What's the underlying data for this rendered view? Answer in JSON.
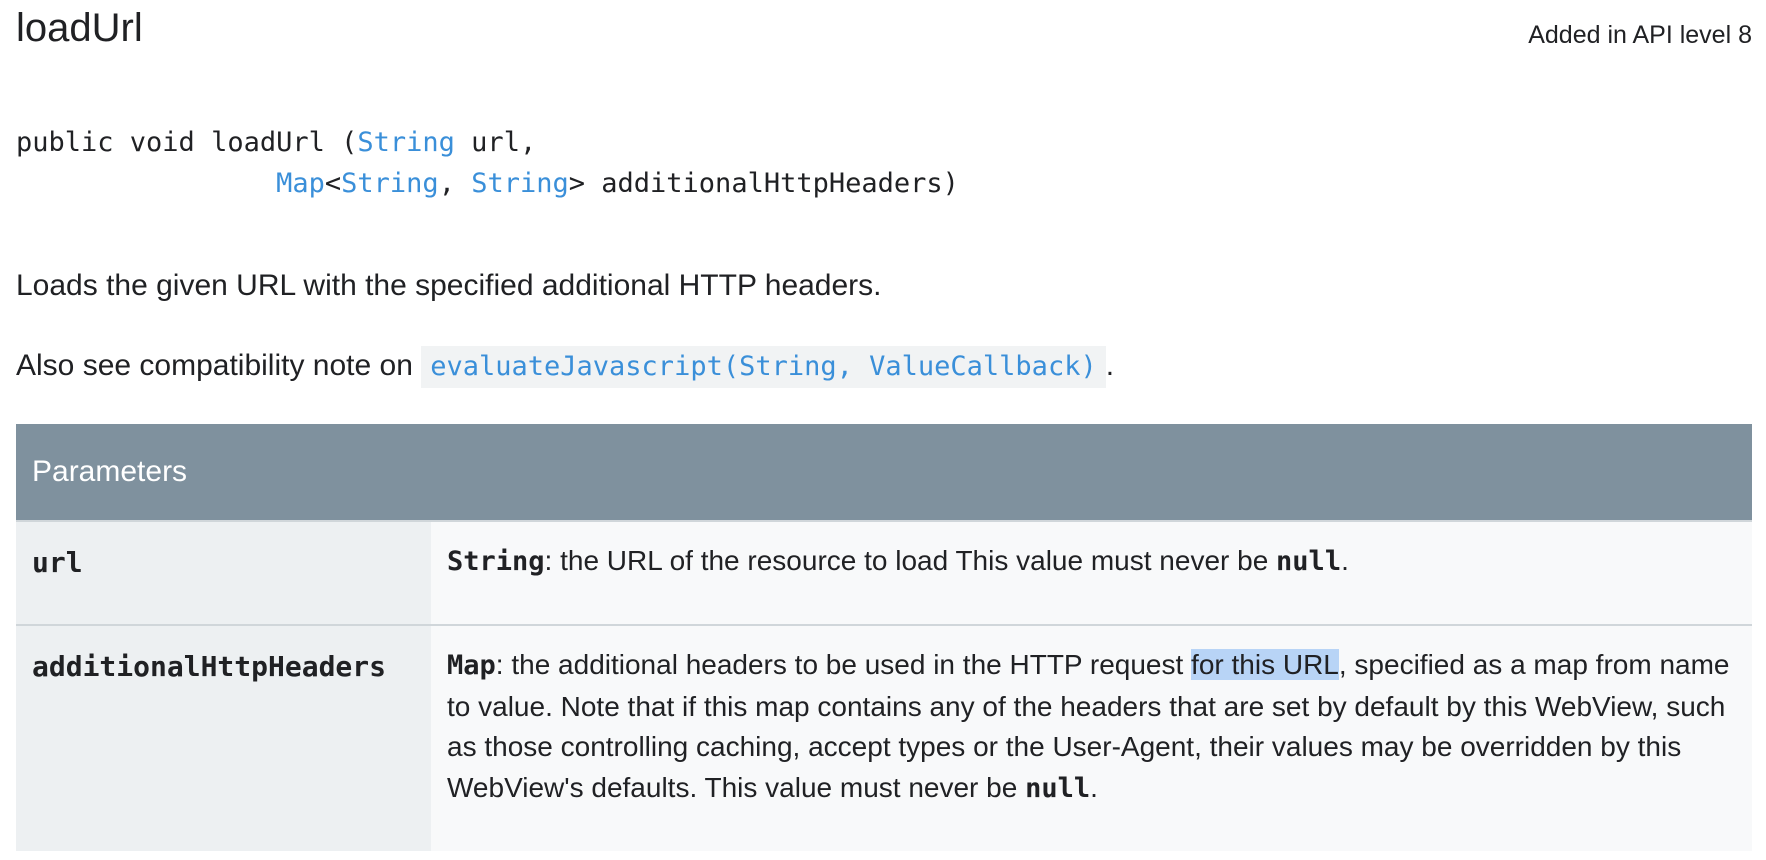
{
  "method": {
    "name": "loadUrl",
    "api_level": "Added in API level 8"
  },
  "signature": {
    "prefix": "public void loadUrl (",
    "type_string_1": "String",
    "param_url": " url,",
    "indent": "                ",
    "type_map": "Map",
    "lt": "<",
    "type_string_2": "String",
    "comma": ", ",
    "type_string_3": "String",
    "gt": ">",
    "param_headers": " additionalHttpHeaders)"
  },
  "description": {
    "line1": "Loads the given URL with the specified additional HTTP headers.",
    "line2_prefix": "Also see compatibility note on ",
    "line2_link": "evaluateJavascript(String, ValueCallback)",
    "line2_suffix": "."
  },
  "parameters": {
    "header": "Parameters",
    "rows": [
      {
        "name": "url",
        "type": "String",
        "desc_1": ": the URL of the resource to load This value must never be ",
        "null_word": "null",
        "desc_end": "."
      },
      {
        "name": "additionalHttpHeaders",
        "type": "Map",
        "desc_1": ": the additional headers to be used in the HTTP request ",
        "highlighted": "for this URL",
        "desc_2": ", specified as a map from name to value. Note that if this map contains any of the headers that are set by default by this WebView, such as those controlling caching, accept types or the User-Agent, their values may be overridden by this WebView's defaults. This value must never be ",
        "null_word": "null",
        "desc_end": "."
      }
    ]
  },
  "colors": {
    "link": "#3a8fd9",
    "table_header": "#7f919e",
    "name_cell": "#edf0f2",
    "desc_cell": "#f8f9fa",
    "selection": "#b8d4f6"
  }
}
